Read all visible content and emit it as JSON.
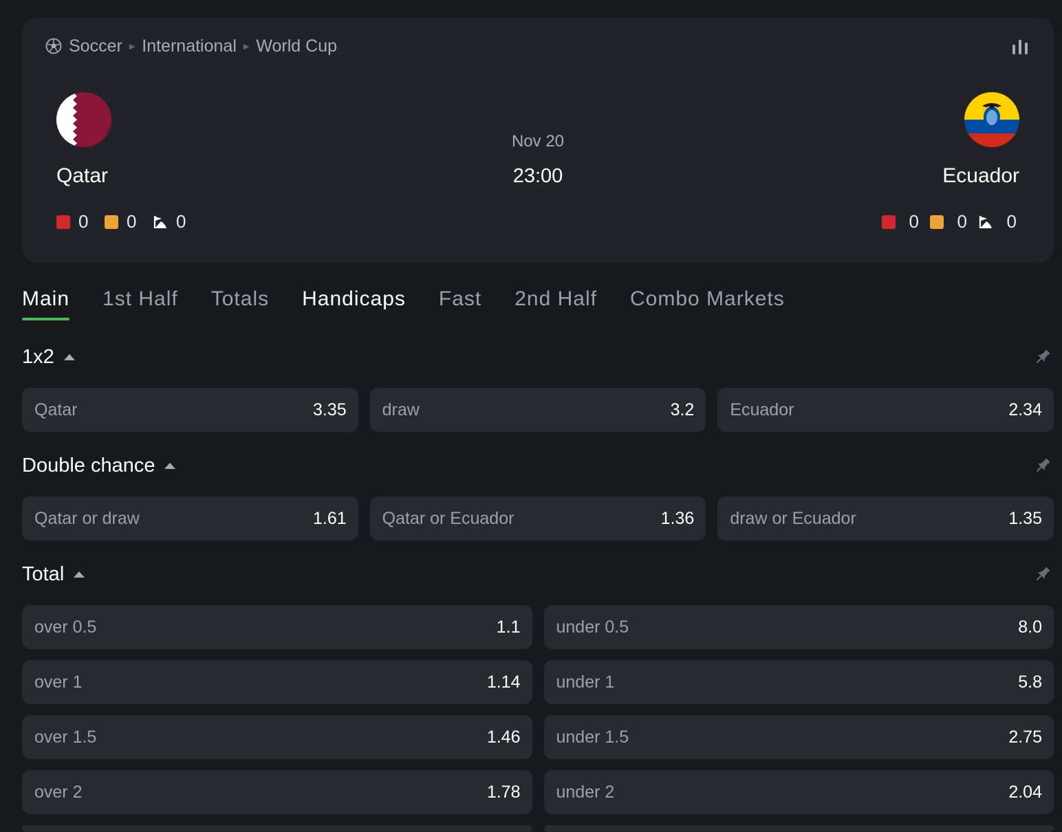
{
  "breadcrumb": [
    "Soccer",
    "International",
    "World Cup"
  ],
  "match": {
    "home": {
      "name": "Qatar",
      "red_cards": "0",
      "yellow_cards": "0",
      "corners": "0"
    },
    "away": {
      "name": "Ecuador",
      "red_cards": "0",
      "yellow_cards": "0",
      "corners": "0"
    },
    "date": "Nov 20",
    "time": "23:00"
  },
  "tabs": [
    "Main",
    "1st Half",
    "Totals",
    "Handicaps",
    "Fast",
    "2nd Half",
    "Combo Markets"
  ],
  "active_tab": "Main",
  "markets": {
    "m1x2": {
      "title": "1x2",
      "outcomes": [
        {
          "label": "Qatar",
          "odd": "3.35"
        },
        {
          "label": "draw",
          "odd": "3.2"
        },
        {
          "label": "Ecuador",
          "odd": "2.34"
        }
      ]
    },
    "double_chance": {
      "title": "Double chance",
      "outcomes": [
        {
          "label": "Qatar or draw",
          "odd": "1.61"
        },
        {
          "label": "Qatar or Ecuador",
          "odd": "1.36"
        },
        {
          "label": "draw or Ecuador",
          "odd": "1.35"
        }
      ]
    },
    "total": {
      "title": "Total",
      "rows": [
        [
          {
            "label": "over 0.5",
            "odd": "1.1"
          },
          {
            "label": "under 0.5",
            "odd": "8.0"
          }
        ],
        [
          {
            "label": "over 1",
            "odd": "1.14"
          },
          {
            "label": "under 1",
            "odd": "5.8"
          }
        ],
        [
          {
            "label": "over 1.5",
            "odd": "1.46"
          },
          {
            "label": "under 1.5",
            "odd": "2.75"
          }
        ],
        [
          {
            "label": "over 2",
            "odd": "1.78"
          },
          {
            "label": "under 2",
            "odd": "2.04"
          }
        ]
      ]
    }
  },
  "colors": {
    "background": "#18191d",
    "card": "#222328",
    "odd_button": "#292a30",
    "accent_green": "#49b95b",
    "red_card": "#d1282f",
    "yellow_card": "#e9a43c",
    "qatar_maroon": "#8a1538",
    "ecuador_yellow": "#ffd100",
    "ecuador_blue": "#034ea2",
    "ecuador_red": "#d52b1e"
  },
  "icons": [
    "soccer-ball-icon",
    "stats-icon",
    "red-card-icon",
    "yellow-card-icon",
    "corner-flag-icon",
    "pin-icon",
    "caret-up-icon"
  ]
}
